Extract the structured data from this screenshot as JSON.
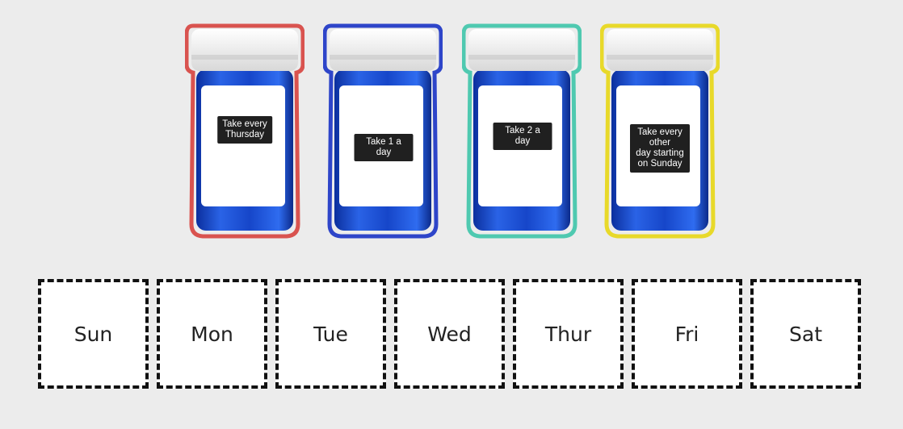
{
  "bottles": [
    {
      "label": "Take every\nThursday",
      "outline_color": "#d9534f",
      "icon": "pill-bottle-icon"
    },
    {
      "label": "Take 1 a day",
      "outline_color": "#2e45c9",
      "icon": "pill-bottle-icon"
    },
    {
      "label": "Take 2 a day",
      "outline_color": "#4fc9b0",
      "icon": "pill-bottle-icon"
    },
    {
      "label": "Take every other\nday starting\non Sunday",
      "outline_color": "#e8d92a",
      "icon": "pill-bottle-icon"
    }
  ],
  "days": [
    "Sun",
    "Mon",
    "Tue",
    "Wed",
    "Thur",
    "Fri",
    "Sat"
  ]
}
